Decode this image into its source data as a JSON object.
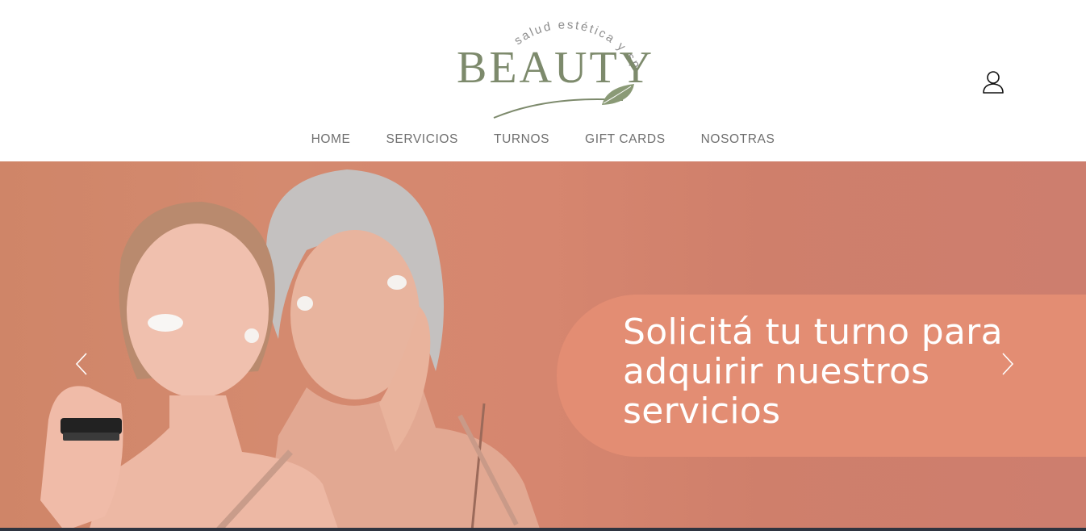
{
  "brand": {
    "arc_text": "salud estética y spa",
    "name": "BEAUTY",
    "colors": {
      "logo_green": "#7d8a6c",
      "leaf": "#8a9a76"
    }
  },
  "header": {
    "user_icon": "user-icon"
  },
  "nav": {
    "items": [
      {
        "label": "HOME"
      },
      {
        "label": "SERVICIOS"
      },
      {
        "label": "TURNOS"
      },
      {
        "label": "GIFT CARDS"
      },
      {
        "label": "NOSOTRAS"
      }
    ]
  },
  "hero": {
    "headline": "Solicitá tu turno para adquirir nuestros servicios",
    "prev_icon": "chevron-left-icon",
    "next_icon": "chevron-right-icon",
    "colors": {
      "background": "#d3876e",
      "pill": "#e38d73",
      "text": "#ffffff"
    }
  }
}
